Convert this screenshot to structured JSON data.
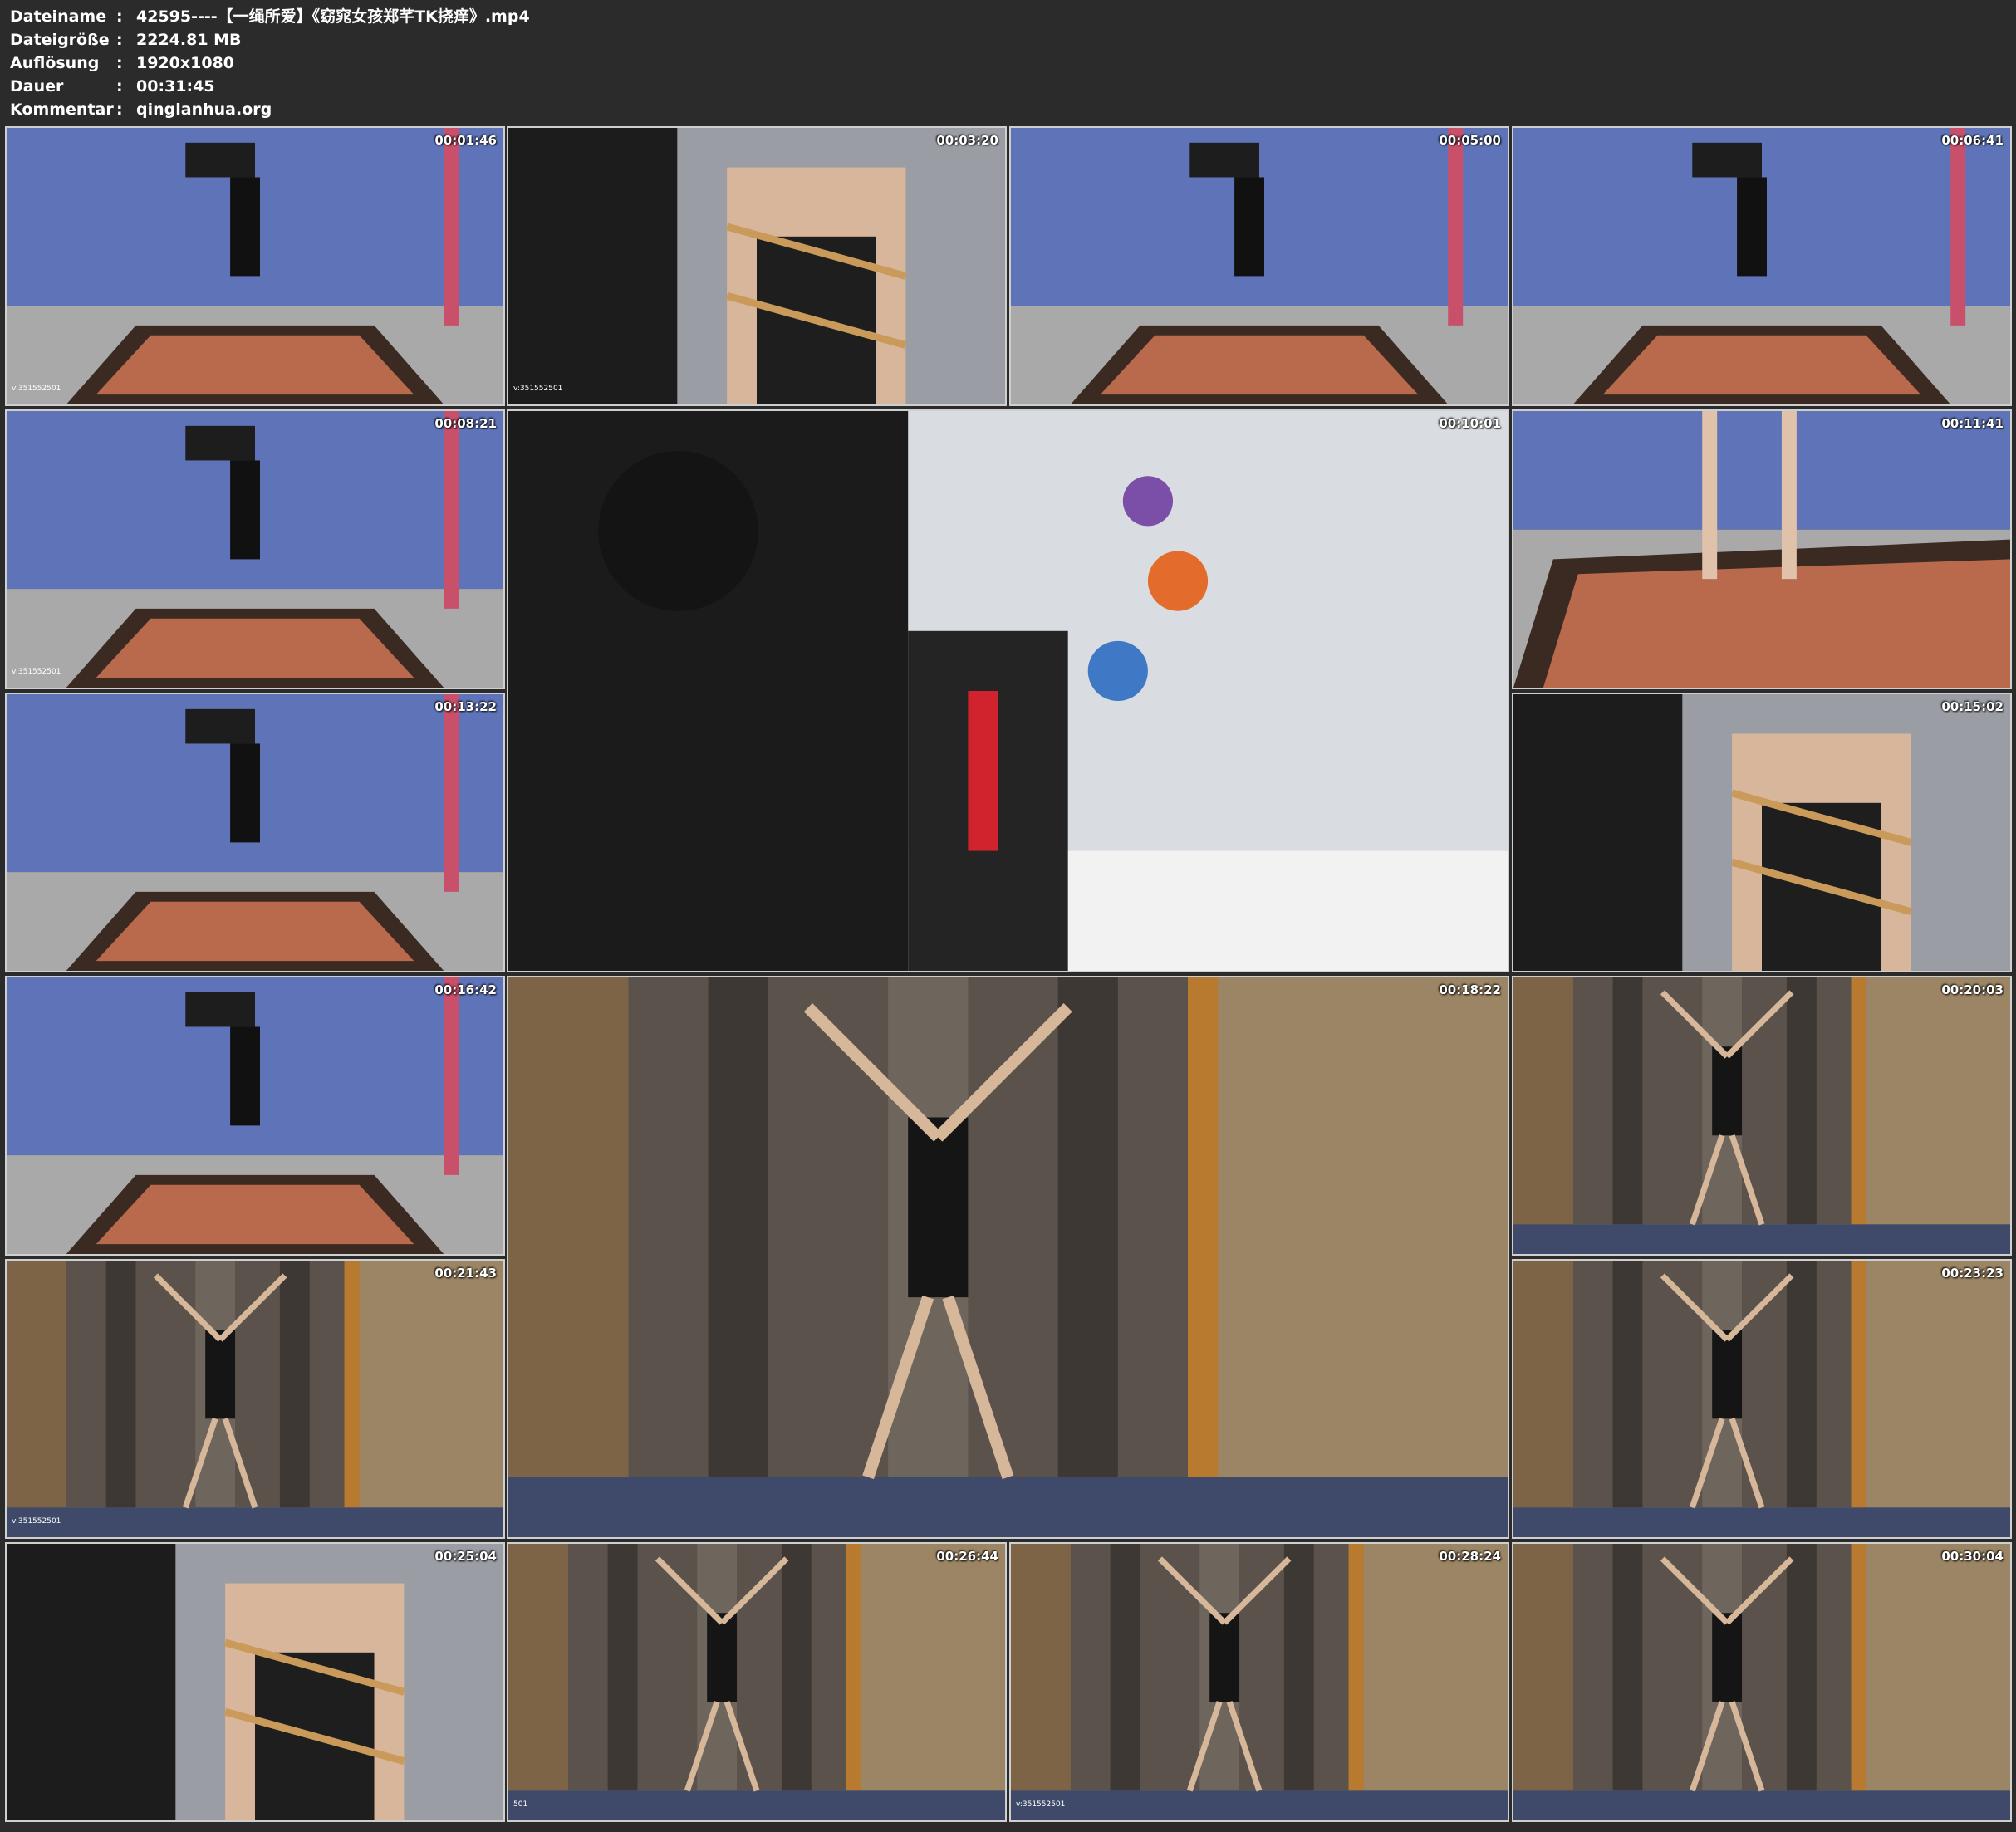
{
  "info": {
    "filename_label": "Dateiname",
    "filename_value": "42595----【一绳所爱】《窈窕女孩郑芊TK挠痒》.mp4",
    "size_label": "Dateigröße",
    "size_value": "2224.81 MB",
    "resolution_label": "Auflösung",
    "resolution_value": "1920x1080",
    "duration_label": "Dauer",
    "duration_value": "00:31:45",
    "comment_label": "Kommentar",
    "comment_value": "qinglanhua.org",
    "separator": ":"
  },
  "thumbnails": [
    {
      "timestamp": "00:01:46",
      "scene": "blue-room",
      "watermark": "v:351552501"
    },
    {
      "timestamp": "00:03:20",
      "scene": "closeup",
      "watermark": "v:351552501"
    },
    {
      "timestamp": "00:05:00",
      "scene": "blue-room",
      "watermark": ""
    },
    {
      "timestamp": "00:06:41",
      "scene": "blue-room",
      "watermark": ""
    },
    {
      "timestamp": "00:08:21",
      "scene": "blue-room",
      "watermark": "v:351552501"
    },
    {
      "timestamp": "00:10:01",
      "scene": "ceiling",
      "watermark": ""
    },
    {
      "timestamp": "00:11:41",
      "scene": "carpet",
      "watermark": ""
    },
    {
      "timestamp": "00:13:22",
      "scene": "blue-room",
      "watermark": ""
    },
    {
      "timestamp": "00:15:02",
      "scene": "closeup",
      "watermark": ""
    },
    {
      "timestamp": "00:16:42",
      "scene": "blue-room",
      "watermark": ""
    },
    {
      "timestamp": "00:18:22",
      "scene": "brick-room",
      "watermark": ""
    },
    {
      "timestamp": "00:20:03",
      "scene": "brick-room",
      "watermark": ""
    },
    {
      "timestamp": "00:21:43",
      "scene": "brick-room",
      "watermark": "v:351552501"
    },
    {
      "timestamp": "00:23:23",
      "scene": "brick-room",
      "watermark": ""
    },
    {
      "timestamp": "00:25:04",
      "scene": "closeup",
      "watermark": ""
    },
    {
      "timestamp": "00:26:44",
      "scene": "brick-room",
      "watermark": "501"
    },
    {
      "timestamp": "00:28:24",
      "scene": "brick-room",
      "watermark": "v:351552501"
    },
    {
      "timestamp": "00:30:04",
      "scene": "brick-room",
      "watermark": ""
    }
  ]
}
